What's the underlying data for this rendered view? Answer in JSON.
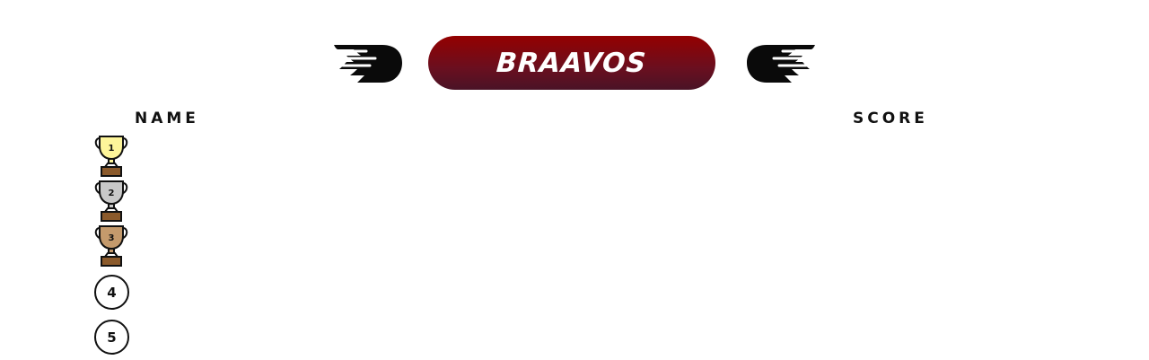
{
  "header": {
    "title": "BRAAVOS"
  },
  "table": {
    "name_header": "NAME",
    "score_header": "SCORE"
  },
  "ranks": [
    {
      "rank": "1",
      "icon": "gold-trophy-icon",
      "color": "#fdf59a"
    },
    {
      "rank": "2",
      "icon": "silver-trophy-icon",
      "color": "#c9c9c9"
    },
    {
      "rank": "3",
      "icon": "bronze-trophy-icon",
      "color": "#c49a6c"
    },
    {
      "rank": "4",
      "icon": "circle-badge-icon"
    },
    {
      "rank": "5",
      "icon": "circle-badge-icon"
    }
  ],
  "colors": {
    "pill_top": "#940000",
    "pill_bottom": "#4a1326",
    "wing": "#0a0a0a",
    "trophy_base": "#8b5a2b"
  }
}
